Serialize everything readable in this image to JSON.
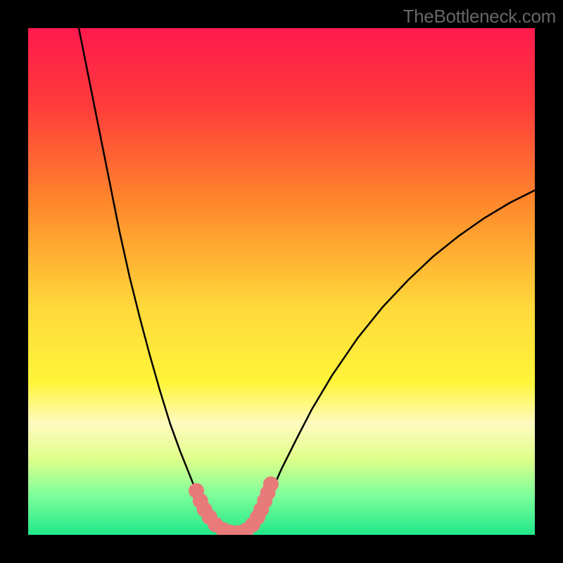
{
  "watermark": "TheBottleneck.com",
  "chart_data": {
    "type": "line",
    "title": "",
    "xlabel": "",
    "ylabel": "",
    "xlim": [
      0,
      100
    ],
    "ylim": [
      0,
      100
    ],
    "background_gradient": {
      "stops": [
        {
          "offset": 0.0,
          "color": "#ff1a4d"
        },
        {
          "offset": 0.15,
          "color": "#ff3b3b"
        },
        {
          "offset": 0.35,
          "color": "#ff8a2b"
        },
        {
          "offset": 0.55,
          "color": "#ffd83a"
        },
        {
          "offset": 0.7,
          "color": "#fff53a"
        },
        {
          "offset": 0.78,
          "color": "#fffac0"
        },
        {
          "offset": 0.85,
          "color": "#dfff8a"
        },
        {
          "offset": 0.92,
          "color": "#80ff9a"
        },
        {
          "offset": 1.0,
          "color": "#20e88a"
        }
      ]
    },
    "series": [
      {
        "name": "bottleneck-curve",
        "stroke": "#000000",
        "stroke_width": 2.5,
        "type": "path",
        "points": [
          {
            "x": 10.0,
            "y": 100.0
          },
          {
            "x": 12.0,
            "y": 90.0
          },
          {
            "x": 14.0,
            "y": 80.0
          },
          {
            "x": 16.0,
            "y": 70.0
          },
          {
            "x": 18.0,
            "y": 60.0
          },
          {
            "x": 20.0,
            "y": 51.0
          },
          {
            "x": 22.0,
            "y": 43.0
          },
          {
            "x": 24.0,
            "y": 35.5
          },
          {
            "x": 26.0,
            "y": 28.5
          },
          {
            "x": 28.0,
            "y": 22.0
          },
          {
            "x": 30.0,
            "y": 16.5
          },
          {
            "x": 32.0,
            "y": 11.5
          },
          {
            "x": 33.0,
            "y": 9.0
          },
          {
            "x": 34.0,
            "y": 6.8
          },
          {
            "x": 35.0,
            "y": 5.0
          },
          {
            "x": 36.0,
            "y": 3.4
          },
          {
            "x": 37.0,
            "y": 2.2
          },
          {
            "x": 38.0,
            "y": 1.3
          },
          {
            "x": 39.0,
            "y": 0.7
          },
          {
            "x": 40.0,
            "y": 0.4
          },
          {
            "x": 41.0,
            "y": 0.3
          },
          {
            "x": 42.0,
            "y": 0.4
          },
          {
            "x": 43.0,
            "y": 0.8
          },
          {
            "x": 44.0,
            "y": 1.5
          },
          {
            "x": 45.0,
            "y": 2.7
          },
          {
            "x": 46.0,
            "y": 4.3
          },
          {
            "x": 47.0,
            "y": 6.3
          },
          {
            "x": 48.0,
            "y": 8.5
          },
          {
            "x": 50.0,
            "y": 13.0
          },
          {
            "x": 53.0,
            "y": 19.0
          },
          {
            "x": 56.0,
            "y": 24.8
          },
          {
            "x": 60.0,
            "y": 31.5
          },
          {
            "x": 65.0,
            "y": 38.8
          },
          {
            "x": 70.0,
            "y": 45.0
          },
          {
            "x": 75.0,
            "y": 50.3
          },
          {
            "x": 80.0,
            "y": 55.0
          },
          {
            "x": 85.0,
            "y": 59.0
          },
          {
            "x": 90.0,
            "y": 62.5
          },
          {
            "x": 95.0,
            "y": 65.5
          },
          {
            "x": 100.0,
            "y": 68.0
          }
        ]
      },
      {
        "name": "highlight-markers",
        "type": "markers",
        "fill": "#e97a7a",
        "radius": 11,
        "points": [
          {
            "x": 33.2,
            "y": 8.7
          },
          {
            "x": 34.0,
            "y": 6.7
          },
          {
            "x": 34.8,
            "y": 5.0
          },
          {
            "x": 35.8,
            "y": 3.5
          },
          {
            "x": 37.0,
            "y": 2.0
          },
          {
            "x": 38.5,
            "y": 1.0
          },
          {
            "x": 40.0,
            "y": 0.5
          },
          {
            "x": 41.5,
            "y": 0.4
          },
          {
            "x": 43.0,
            "y": 0.9
          },
          {
            "x": 44.3,
            "y": 2.0
          },
          {
            "x": 45.3,
            "y": 3.5
          },
          {
            "x": 46.0,
            "y": 5.0
          },
          {
            "x": 46.7,
            "y": 6.7
          },
          {
            "x": 47.3,
            "y": 8.3
          },
          {
            "x": 47.9,
            "y": 10.0
          }
        ]
      }
    ]
  }
}
